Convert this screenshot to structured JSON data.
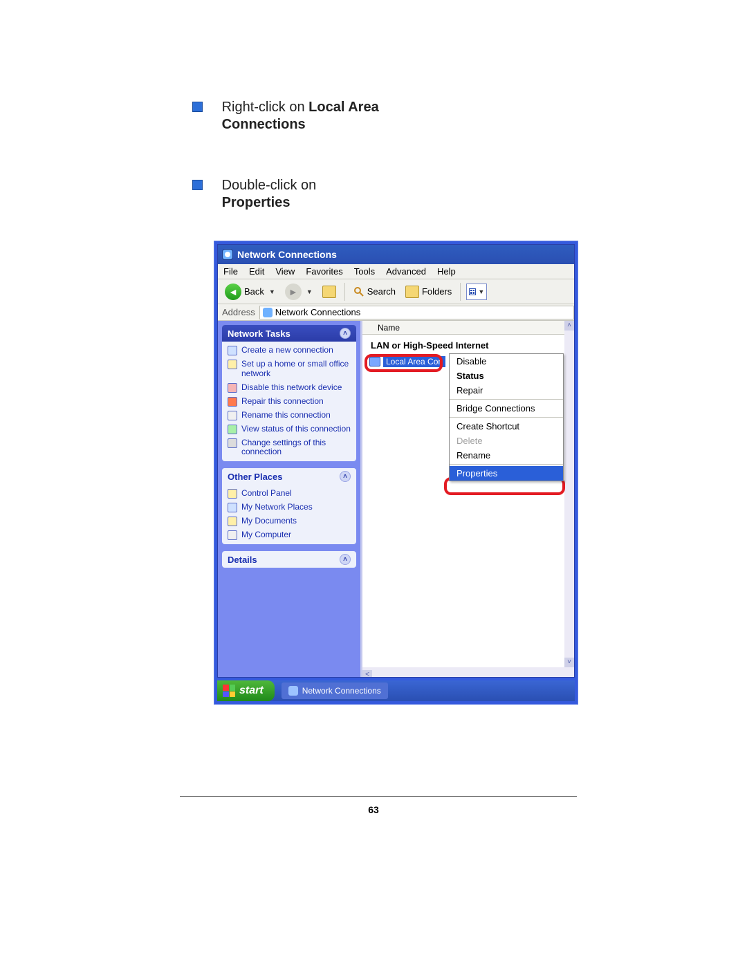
{
  "page_number": "63",
  "instructions": [
    {
      "pre": "Right-click on ",
      "bold": "Local Area Connections"
    },
    {
      "pre": "Double-click on ",
      "bold": "Properties"
    }
  ],
  "window": {
    "title": "Network Connections",
    "menu": [
      "File",
      "Edit",
      "View",
      "Favorites",
      "Tools",
      "Advanced",
      "Help"
    ],
    "toolbar": {
      "back": "Back",
      "search": "Search",
      "folders": "Folders"
    },
    "address": {
      "label": "Address",
      "value": "Network Connections"
    },
    "sidebar": {
      "network_tasks": {
        "title": "Network Tasks",
        "items": [
          "Create a new connection",
          "Set up a home or small office network",
          "Disable this network device",
          "Repair this connection",
          "Rename this connection",
          "View status of this connection",
          "Change settings of this connection"
        ]
      },
      "other_places": {
        "title": "Other Places",
        "items": [
          "Control Panel",
          "My Network Places",
          "My Documents",
          "My Computer"
        ]
      },
      "details": {
        "title": "Details"
      }
    },
    "content": {
      "col_name": "Name",
      "section": "LAN or High-Speed Internet",
      "selected_item": "Local Area Con"
    },
    "context_menu": {
      "items": [
        {
          "label": "Disable",
          "state": "normal"
        },
        {
          "label": "Status",
          "state": "bold"
        },
        {
          "label": "Repair",
          "state": "normal"
        },
        {
          "label": "Bridge Connections",
          "state": "normal"
        },
        {
          "label": "Create Shortcut",
          "state": "normal"
        },
        {
          "label": "Delete",
          "state": "disabled"
        },
        {
          "label": "Rename",
          "state": "normal"
        },
        {
          "label": "Properties",
          "state": "selected"
        }
      ]
    }
  },
  "taskbar": {
    "start": "start",
    "tab": "Network Connections"
  }
}
